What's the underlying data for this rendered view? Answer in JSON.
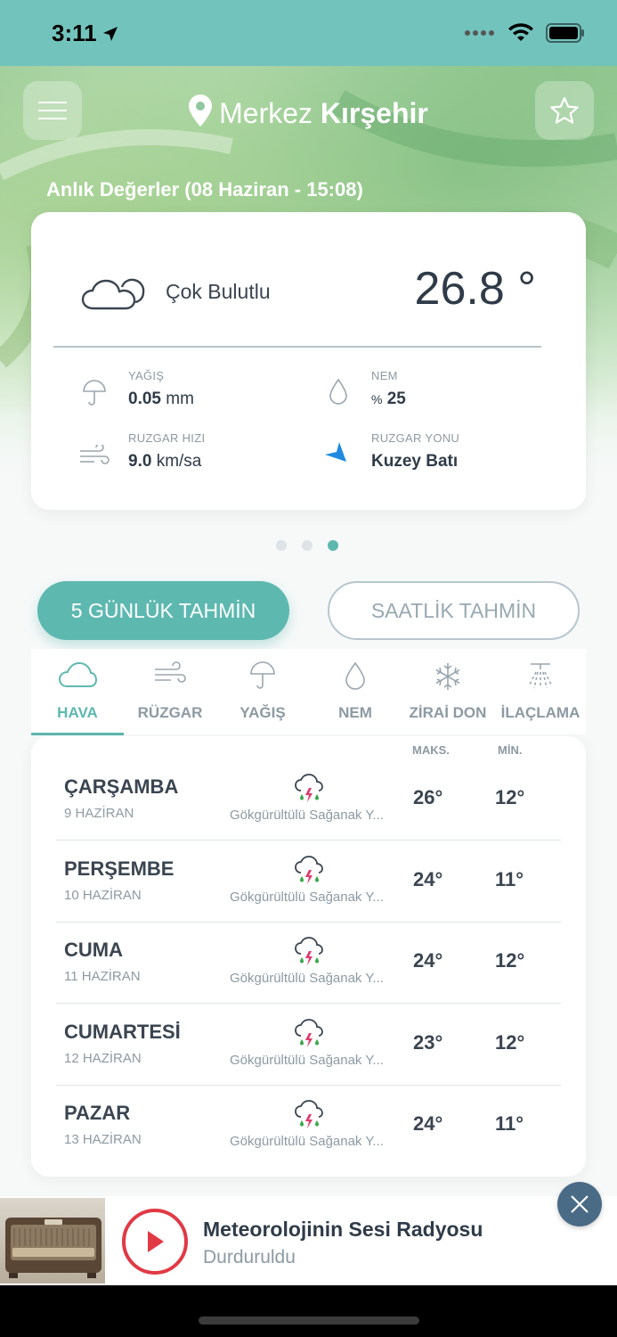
{
  "status_bar": {
    "time": "3:11"
  },
  "header": {
    "location_prefix": "Merkez",
    "location_name": "Kırşehir",
    "instant_title": "Anlık Değerler (08 Haziran - 15:08)"
  },
  "current": {
    "condition": "Çok Bulutlu",
    "temperature": "26.8 °",
    "precip_label": "YAĞIŞ",
    "precip_value": "0.05",
    "precip_unit": "mm",
    "humidity_label": "NEM",
    "humidity_unit": "%",
    "humidity_value": "25",
    "wind_speed_label": "RUZGAR HIZI",
    "wind_speed_value": "9.0",
    "wind_speed_unit": "km/sa",
    "wind_dir_label": "RUZGAR YONU",
    "wind_dir_value": "Kuzey Batı"
  },
  "pager": {
    "count": 3,
    "active_index": 2
  },
  "buttons": {
    "five_day": "5 GÜNLÜK TAHMİN",
    "hourly": "SAATLİK TAHMİN"
  },
  "tabs": [
    {
      "label": "HAVA",
      "icon": "cloud-icon",
      "active": true
    },
    {
      "label": "RÜZGAR",
      "icon": "wind-icon",
      "active": false
    },
    {
      "label": "YAĞIŞ",
      "icon": "umbrella-icon",
      "active": false
    },
    {
      "label": "NEM",
      "icon": "drop-icon",
      "active": false
    },
    {
      "label": "ZİRAİ DON",
      "icon": "snowflake-icon",
      "active": false
    },
    {
      "label": "İLAÇLAMA",
      "icon": "sprayer-icon",
      "active": false
    }
  ],
  "forecast": {
    "max_header": "MAKS.",
    "min_header": "MİN.",
    "days": [
      {
        "day": "ÇARŞAMBA",
        "date": "9 HAZİRAN",
        "condition": "Gökgürültülü Sağanak Y...",
        "max": "26°",
        "min": "12°"
      },
      {
        "day": "PERŞEMBE",
        "date": "10 HAZİRAN",
        "condition": "Gökgürültülü Sağanak Y...",
        "max": "24°",
        "min": "11°"
      },
      {
        "day": "CUMA",
        "date": "11 HAZİRAN",
        "condition": "Gökgürültülü Sağanak Y...",
        "max": "24°",
        "min": "12°"
      },
      {
        "day": "CUMARTESİ",
        "date": "12 HAZİRAN",
        "condition": "Gökgürültülü Sağanak Y...",
        "max": "23°",
        "min": "12°"
      },
      {
        "day": "PAZAR",
        "date": "13 HAZİRAN",
        "condition": "Gökgürültülü Sağanak Y...",
        "max": "24°",
        "min": "11°"
      }
    ]
  },
  "player": {
    "title": "Meteorolojinin Sesi Radyosu",
    "status": "Durduruldu"
  },
  "colors": {
    "accent": "#5db8b0",
    "status_bar": "#73c3bd",
    "play": "#e03a45",
    "wind_arrow": "#1f8be0",
    "close_btn": "#4a6b86"
  }
}
